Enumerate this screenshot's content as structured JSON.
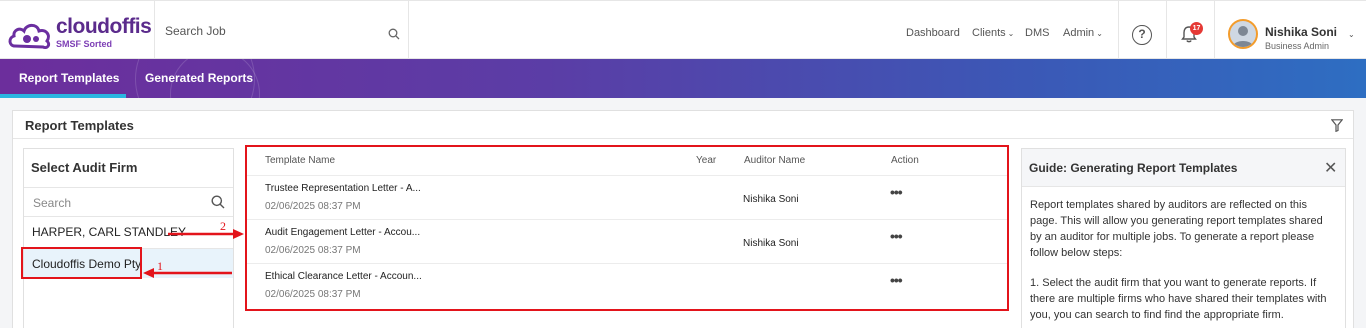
{
  "brand": {
    "name": "cloudoffis",
    "tagline": "SMSF Sorted"
  },
  "search": {
    "placeholder": "Search Job"
  },
  "nav": {
    "dashboard": "Dashboard",
    "clients": "Clients",
    "dms": "DMS",
    "admin": "Admin"
  },
  "notifications": {
    "count": "17"
  },
  "user": {
    "name": "Nishika Soni",
    "role": "Business Admin"
  },
  "tabs": [
    {
      "label": "Report Templates",
      "active": true
    },
    {
      "label": "Generated Reports",
      "active": false
    }
  ],
  "panel": {
    "title": "Report Templates"
  },
  "audit_firm": {
    "title": "Select Audit Firm",
    "search_placeholder": "Search",
    "items": [
      {
        "label": "HARPER, CARL STANDLEY",
        "selected": false
      },
      {
        "label": "Cloudoffis Demo Pty",
        "selected": true
      }
    ]
  },
  "table": {
    "headers": {
      "name": "Template Name",
      "year": "Year",
      "auditor": "Auditor Name",
      "action": "Action"
    },
    "rows": [
      {
        "name": "Trustee Representation Letter - A...",
        "date": "02/06/2025 08:37 PM",
        "year": "",
        "auditor": "Nishika Soni",
        "action": "•••"
      },
      {
        "name": "Audit Engagement Letter - Accou...",
        "date": "02/06/2025 08:37 PM",
        "year": "",
        "auditor": "Nishika Soni",
        "action": "•••"
      },
      {
        "name": "Ethical Clearance Letter - Accoun...",
        "date": "02/06/2025 08:37 PM",
        "year": "",
        "auditor": "",
        "action": "•••"
      }
    ]
  },
  "guide": {
    "title": "Guide: Generating Report Templates",
    "paragraphs": [
      "Report templates shared by auditors are reflected on this page. This will allow you generating report templates shared by an auditor for multiple jobs. To generate a report please follow below steps:",
      "1. Select the audit firm that you want to generate reports. If there are multiple firms who have shared their templates with you, you can search to find find the appropriate firm."
    ]
  },
  "annotations": {
    "step1": "1",
    "step2": "2",
    "color": "#e3141b"
  },
  "colors": {
    "brand": "#5b2b8c",
    "tab_gradient_start": "#6c2e9c",
    "tab_gradient_end": "#2e6ec2",
    "tab_underline": "#2bb6e0",
    "selected_row": "#e8f3fb"
  }
}
